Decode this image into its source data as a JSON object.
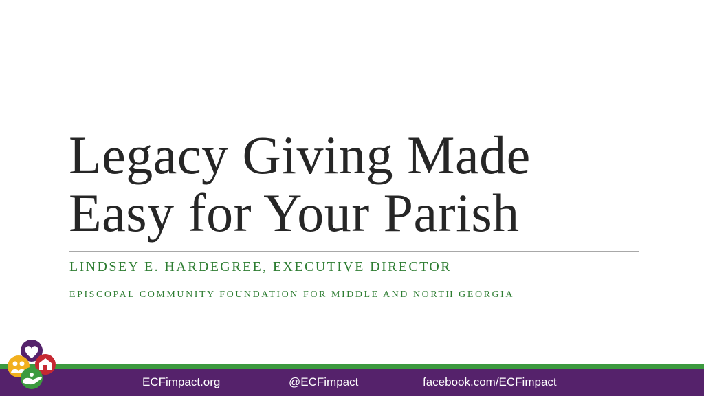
{
  "slide": {
    "title_line1": "Legacy Giving Made",
    "title_line2": "Easy for Your Parish",
    "subtitle": "LINDSEY E. HARDEGREE, EXECUTIVE DIRECTOR",
    "organization": "EPISCOPAL COMMUNITY FOUNDATION FOR MIDDLE AND NORTH GEORGIA"
  },
  "footer": {
    "website": "ECFimpact.org",
    "twitter": "@ECFimpact",
    "facebook": "facebook.com/ECFimpact"
  },
  "colors": {
    "title_text": "#262626",
    "accent_green": "#2e7d32",
    "stripe_green": "#3c9a3f",
    "footer_purple": "#55226b",
    "rule_gray": "#a8a8a8"
  },
  "icons": {
    "logo": "ecf-logo-icon"
  }
}
